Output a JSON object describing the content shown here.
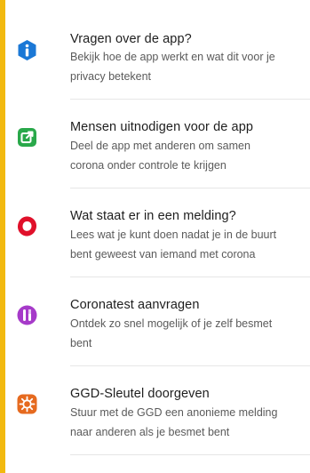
{
  "items": [
    {
      "title": "Vragen over de app?",
      "desc_line1": "Bekijk hoe de app werkt en wat dit voor je",
      "desc_line2": "privacy betekent",
      "icon": "info-icon",
      "color": "#1b78d6"
    },
    {
      "title": "Mensen uitnodigen voor de app",
      "desc_line1": "Deel de app met anderen om samen",
      "desc_line2": "corona onder controle te krijgen",
      "icon": "share-icon",
      "color": "#29a84a"
    },
    {
      "title": "Wat staat er in een melding?",
      "desc_line1": "Lees wat je kunt doen nadat je in de buurt",
      "desc_line2": "bent geweest van iemand met corona",
      "icon": "notification-icon",
      "color": "#e0102a"
    },
    {
      "title": "Coronatest aanvragen",
      "desc_line1": "Ontdek zo snel mogelijk of je zelf besmet",
      "desc_line2": "bent",
      "icon": "test-tube-icon",
      "color": "#a63ac9"
    },
    {
      "title": "GGD-Sleutel doorgeven",
      "desc_line1": "Stuur met de GGD een anonieme melding",
      "desc_line2": "naar anderen als je besmet bent",
      "icon": "virus-icon",
      "color": "#e66a1f"
    }
  ]
}
